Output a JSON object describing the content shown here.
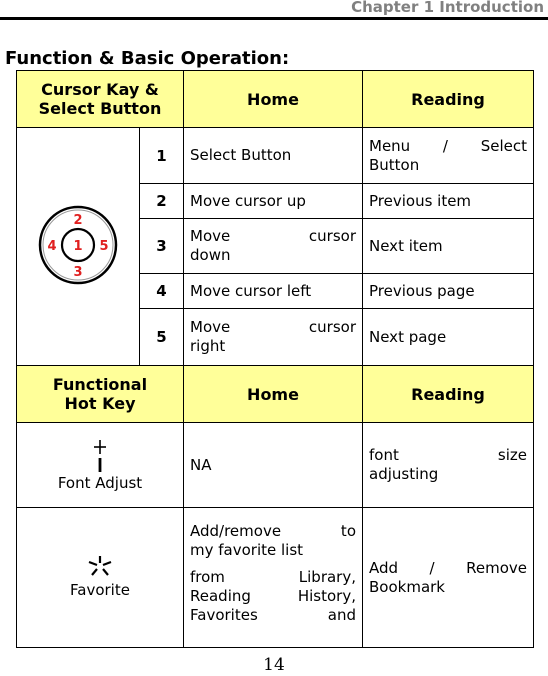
{
  "header": {
    "chapter": "Chapter 1 Introduction"
  },
  "section_title": "Function & Basic Operation:",
  "table1": {
    "headers": [
      "Cursor Kay & Select Button",
      "Home",
      "Reading"
    ],
    "header_line1": "Cursor Kay &",
    "header_line2": "Select Button",
    "icon": "cursor-keypad-icon",
    "icon_labels": [
      "1",
      "2",
      "3",
      "4",
      "5"
    ],
    "icon_color": "#E02020",
    "rows": [
      {
        "num": "1",
        "home": "Select Button",
        "reading_l1": "Menu / Select",
        "reading_l2": "Button"
      },
      {
        "num": "2",
        "home": "Move cursor up",
        "reading": "Previous item"
      },
      {
        "num": "3",
        "home_l1": "Move cursor",
        "home_l2": "down",
        "reading": "Next item"
      },
      {
        "num": "4",
        "home": "Move cursor left",
        "reading": "Previous page"
      },
      {
        "num": "5",
        "home_l1": "Move cursor",
        "home_l2": "right",
        "reading": "Next page"
      }
    ]
  },
  "table2": {
    "header_line1": "Functional",
    "header_line2": "Hot Key",
    "headers": [
      "Functional Hot Key",
      "Home",
      "Reading"
    ],
    "rows": [
      {
        "icon": "plus-minus-icon",
        "key": "Font Adjust",
        "home": "NA",
        "reading_l1": "font size",
        "reading_l2": "adjusting"
      },
      {
        "icon": "asterisk-favorite-icon",
        "key": "Favorite",
        "home_p1_l1": "Add/remove to",
        "home_p1_l2": "my favorite list",
        "home_p2_l1": "from Library,",
        "home_p2_l2": "Reading History,",
        "home_p2_l3": "Favorites and",
        "reading_l1": "Add / Remove",
        "reading_l2": "Bookmark"
      }
    ]
  },
  "colors": {
    "header_bg": "#FFFF99",
    "chapter_text": "#808080"
  },
  "page_number": "14"
}
